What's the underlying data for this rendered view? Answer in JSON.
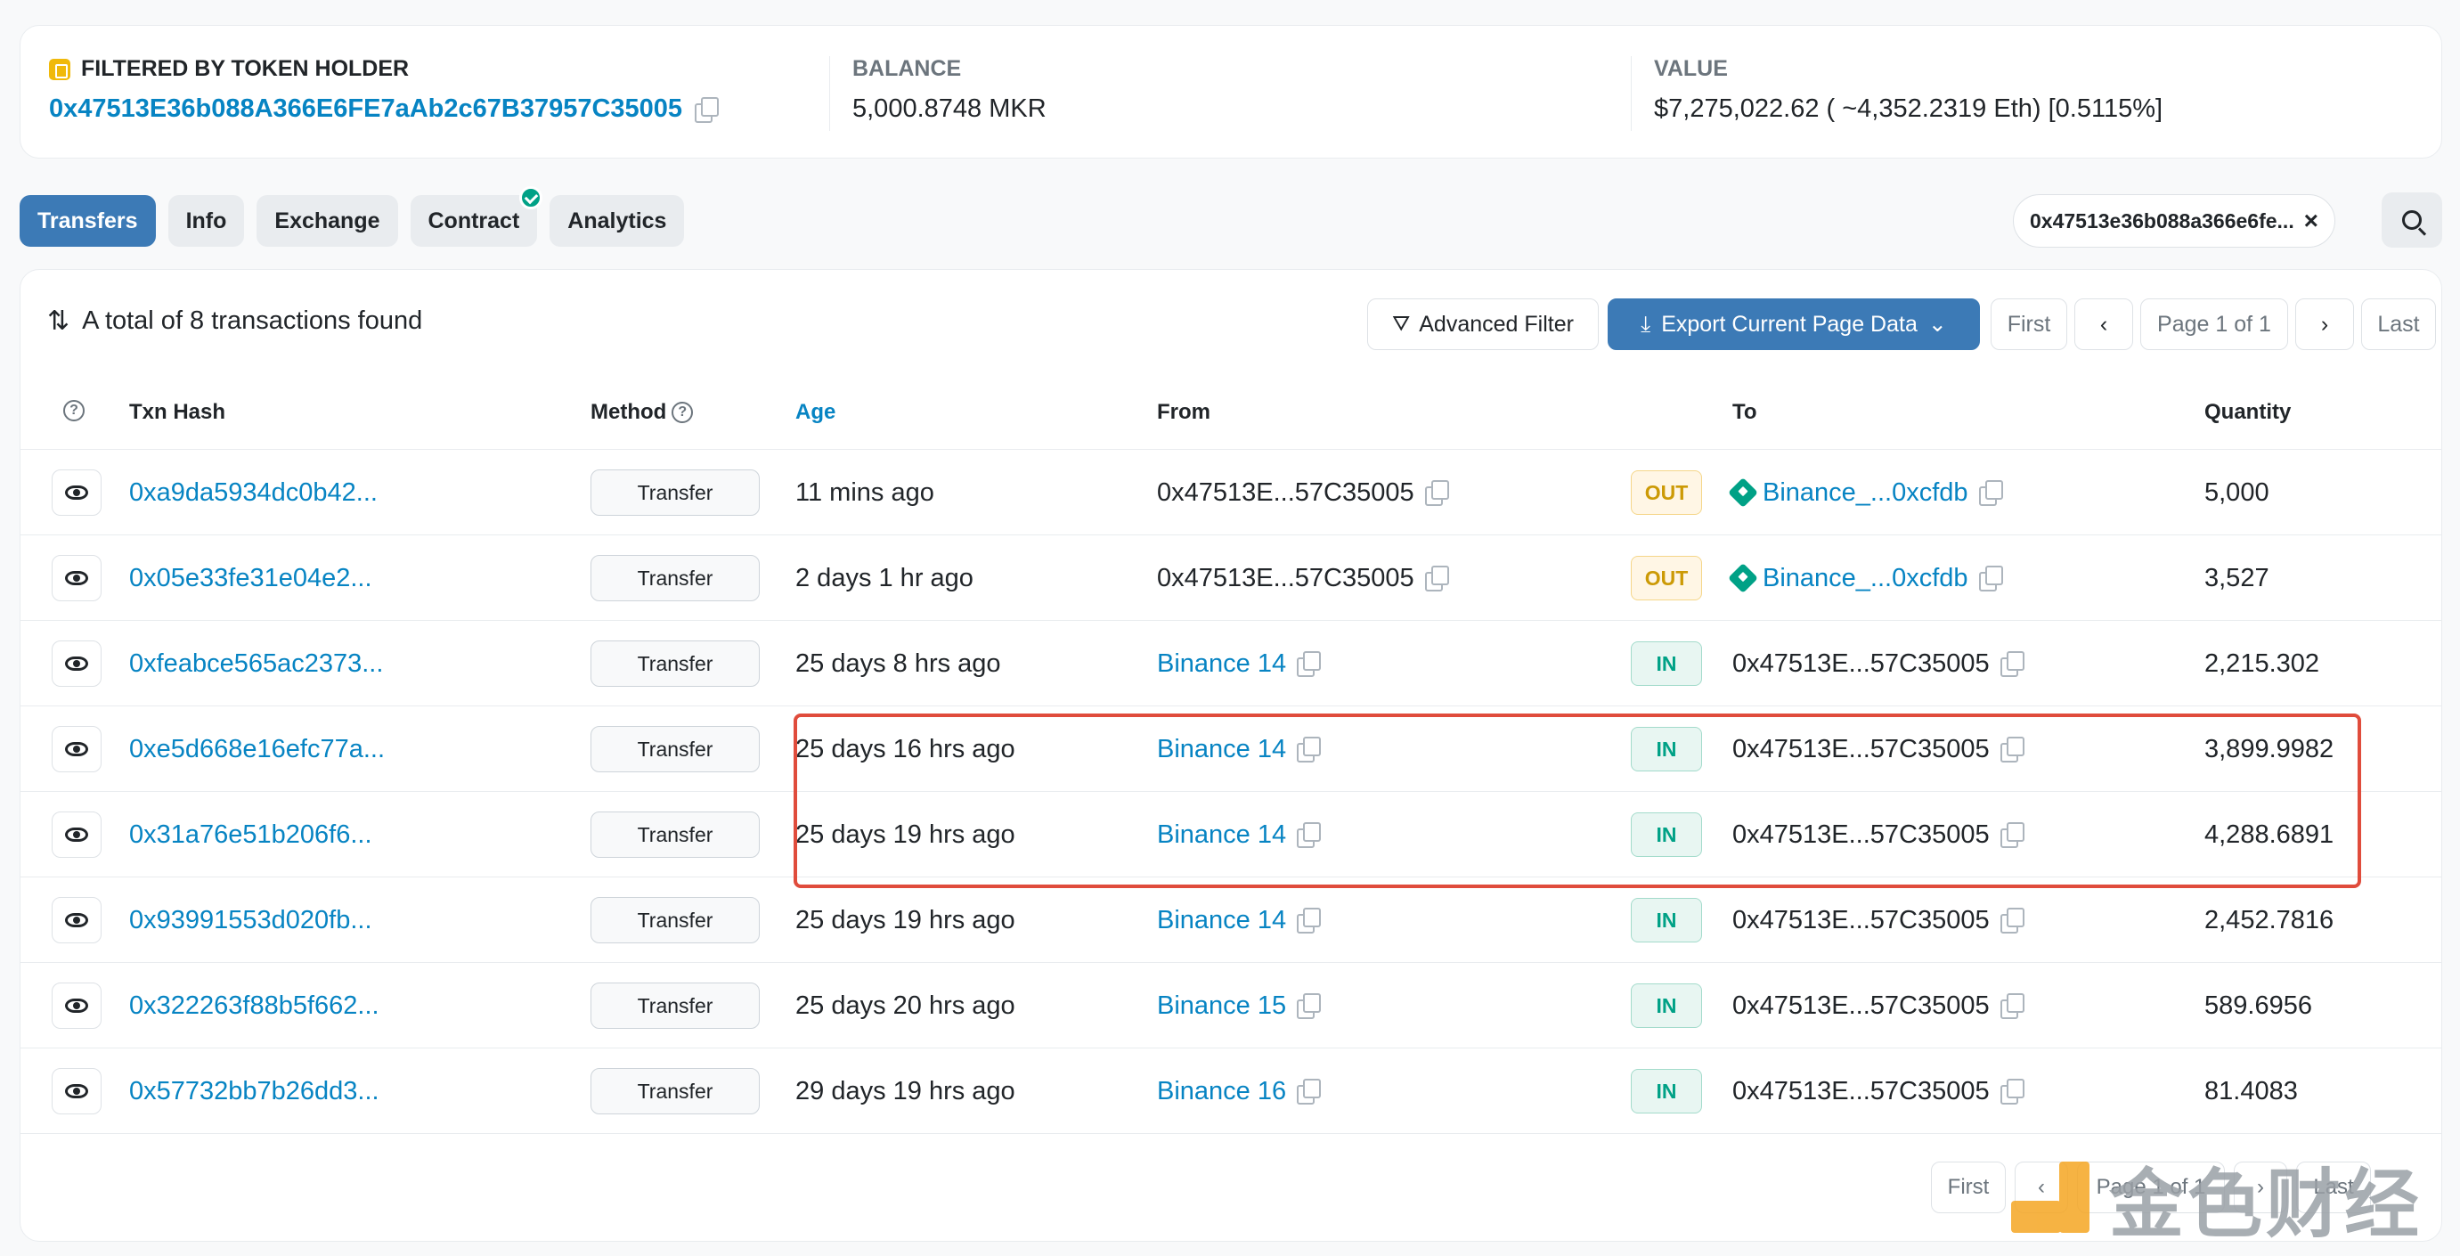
{
  "summary": {
    "filtered_label": "FILTERED BY TOKEN HOLDER",
    "holder_address": "0x47513E36b088A366E6FE7aAb2c67B37957C35005",
    "balance_label": "BALANCE",
    "balance_value": "5,000.8748 MKR",
    "value_label": "VALUE",
    "value_value": "$7,275,022.62 ( ~4,352.2319 Eth) [0.5115%]"
  },
  "tabs": [
    {
      "label": "Transfers",
      "active": true
    },
    {
      "label": "Info"
    },
    {
      "label": "Exchange"
    },
    {
      "label": "Contract",
      "verified": true
    },
    {
      "label": "Analytics"
    }
  ],
  "address_filter": "0x47513e36b088a366e6fe...",
  "toolbar": {
    "total_text": "A total of 8 transactions found",
    "advanced_filter": "Advanced Filter",
    "export": "Export Current Page Data",
    "first": "First",
    "page": "Page 1 of 1",
    "last": "Last"
  },
  "columns": {
    "txn_hash": "Txn Hash",
    "method": "Method",
    "age": "Age",
    "from": "From",
    "to": "To",
    "quantity": "Quantity"
  },
  "rows": [
    {
      "hash": "0xa9da5934dc0b42...",
      "method": "Transfer",
      "age": "11 mins ago",
      "from": "0x47513E...57C35005",
      "from_link": false,
      "dir": "OUT",
      "to": "Binance_...0xcfdb",
      "to_link": true,
      "qty": "5,000"
    },
    {
      "hash": "0x05e33fe31e04e2...",
      "method": "Transfer",
      "age": "2 days 1 hr ago",
      "from": "0x47513E...57C35005",
      "from_link": false,
      "dir": "OUT",
      "to": "Binance_...0xcfdb",
      "to_link": true,
      "qty": "3,527"
    },
    {
      "hash": "0xfeabce565ac2373...",
      "method": "Transfer",
      "age": "25 days 8 hrs ago",
      "from": "Binance 14",
      "from_link": true,
      "dir": "IN",
      "to": "0x47513E...57C35005",
      "to_link": false,
      "qty": "2,215.302"
    },
    {
      "hash": "0xe5d668e16efc77a...",
      "method": "Transfer",
      "age": "25 days 16 hrs ago",
      "from": "Binance 14",
      "from_link": true,
      "dir": "IN",
      "to": "0x47513E...57C35005",
      "to_link": false,
      "qty": "3,899.9982"
    },
    {
      "hash": "0x31a76e51b206f6...",
      "method": "Transfer",
      "age": "25 days 19 hrs ago",
      "from": "Binance 14",
      "from_link": true,
      "dir": "IN",
      "to": "0x47513E...57C35005",
      "to_link": false,
      "qty": "4,288.6891"
    },
    {
      "hash": "0x93991553d020fb...",
      "method": "Transfer",
      "age": "25 days 19 hrs ago",
      "from": "Binance 14",
      "from_link": true,
      "dir": "IN",
      "to": "0x47513E...57C35005",
      "to_link": false,
      "qty": "2,452.7816"
    },
    {
      "hash": "0x322263f88b5f662...",
      "method": "Transfer",
      "age": "25 days 20 hrs ago",
      "from": "Binance 15",
      "from_link": true,
      "dir": "IN",
      "to": "0x47513E...57C35005",
      "to_link": false,
      "qty": "589.6956"
    },
    {
      "hash": "0x57732bb7b26dd3...",
      "method": "Transfer",
      "age": "29 days 19 hrs ago",
      "from": "Binance 16",
      "from_link": true,
      "dir": "IN",
      "to": "0x47513E...57C35005",
      "to_link": false,
      "qty": "81.4083"
    }
  ],
  "bottom_pager": {
    "first": "First",
    "page": "Page 1 of 1",
    "last": "Last"
  },
  "watermark": "金色财经",
  "colors": {
    "accent": "#3c7ab6",
    "link": "#0784c3",
    "out": "#cc9a06",
    "in": "#00a186",
    "highlight": "#e04c3c"
  }
}
